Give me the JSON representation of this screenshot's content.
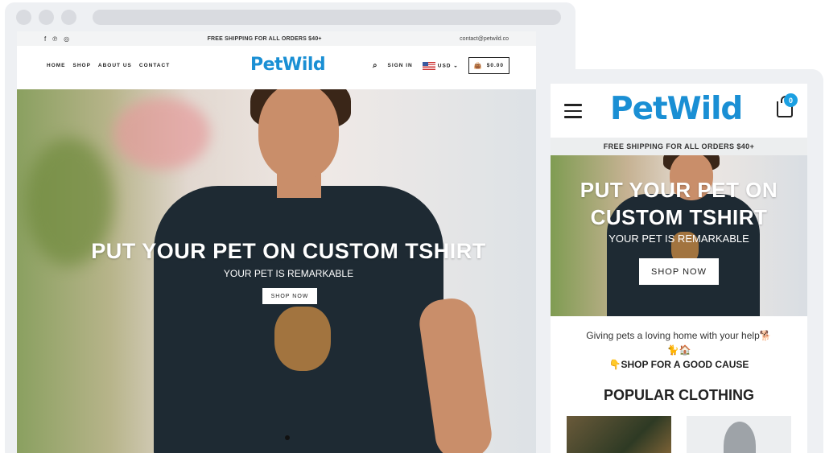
{
  "desktop": {
    "topbar": {
      "shipping": "FREE SHIPPING FOR ALL ORDERS $40+",
      "email": "contact@petwild.co",
      "social_icons": [
        "facebook-icon",
        "pinterest-icon",
        "instagram-icon"
      ]
    },
    "nav": {
      "links": [
        "HOME",
        "SHOP",
        "ABOUT US",
        "CONTACT"
      ],
      "logo": "PetWild",
      "sign_in": "SIGN IN",
      "currency": "USD",
      "cart_total": "$0.00"
    },
    "hero": {
      "title": "PUT YOUR PET ON CUSTOM TSHIRT",
      "subtitle": "YOUR PET IS REMARKABLE",
      "button": "SHOP NOW"
    }
  },
  "mobile": {
    "logo": "PetWild",
    "cart_count": "0",
    "shipping": "FREE SHIPPING FOR ALL ORDERS $40+",
    "hero": {
      "title_line1": "PUT YOUR PET ON",
      "title_line2": "CUSTOM TSHIRT",
      "subtitle": "YOUR PET IS REMARKABLE",
      "button": "SHOP NOW"
    },
    "tagline": "Giving pets a loving home with your help🐕",
    "tagline_emoji": "🐈🏠",
    "cause": "👇SHOP FOR A GOOD CAUSE",
    "section_title": "POPULAR CLOTHING"
  },
  "colors": {
    "brand_blue": "#1a8fd4",
    "badge_blue": "#1ba0e2"
  }
}
